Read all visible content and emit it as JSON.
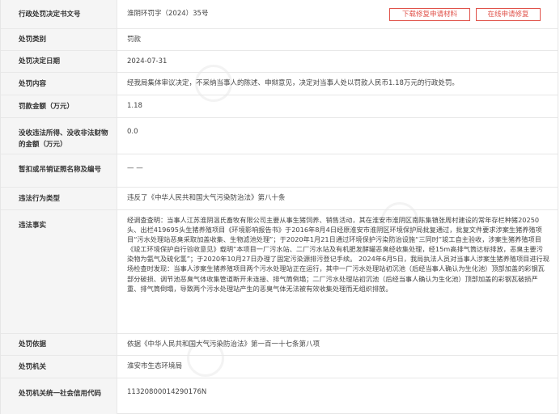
{
  "doc_number": {
    "label": "行政处罚决定书文号",
    "value": "淮阴环罚字（2024）35号"
  },
  "buttons": {
    "download": "下载修复申请材料",
    "online": "在线申请修复"
  },
  "category": {
    "label": "处罚类别",
    "value": "罚款"
  },
  "date": {
    "label": "处罚决定日期",
    "value": "2024-07-31"
  },
  "content": {
    "label": "处罚内容",
    "value": "经我局集体审议决定，不采纳当事人的陈述、申辩意见，决定对当事人处以罚款人民币1.18万元的行政处罚。"
  },
  "amount": {
    "label": "罚款金额（万元）",
    "value": "1.18"
  },
  "confiscation": {
    "label": "没收违法所得、没收非法财物的金额（万元）",
    "value": "0.0"
  },
  "license": {
    "label": "暂扣或吊销证照名称及编号",
    "value": "— —"
  },
  "violation_type": {
    "label": "违法行为类型",
    "value": "违反了《中华人民共和国大气污染防治法》第八十条"
  },
  "facts": {
    "label": "违法事实",
    "value": "经调查查明：当事人江苏淮阴温氏畜牧有限公司主要从事生猪饲养、销售活动，其在淮安市淮阴区南陈集镇张周村建设的常年存栏种猪20250头、出栏419695头生猪养殖项目《环境影响报告书》于2016年8月4日经原淮安市淮阴区环境保护局批复通过，批复文件要求涉案生猪养殖项目“污水处理站恶臭采取加盖收集、生物滤池处理”；于2020年1月21日通过环境保护污染防治设施“三同时”竣工自主验收，涉案生猪养殖项目《竣工环境保护自行验收意见》载明“本项目一厂污水站、二厂污水站及有机肥发酵罐恶臭经收集处理，经15m高排气筒达标排放，恶臭主要污染物为氨气及硫化氢”；于2020年10月27日办理了固定污染源排污登记手续。 2024年6月5日，我局执法人员对当事人涉案生猪养殖项目进行现场检查时发现：当事人涉案生猪养殖项目两个污水处理站正在运行，其中一厂污水处理站初沉池（后经当事人确认为生化池）顶部加盖的彩钢瓦部分破损、调节池恶臭气体收集管道断开未连接、排气筒倒塌；二厂污水处理站初沉池（后经当事人确认为生化池）顶部加盖的彩钢瓦破损严重、排气筒倒塌，导致两个污水处理站产生的恶臭气体无法被有效收集处理而无组织排放。"
  },
  "basis": {
    "label": "处罚依据",
    "value": "依据《中华人民共和国大气污染防治法》第一百一十七条第八项"
  },
  "authority": {
    "label": "处罚机关",
    "value": "淮安市生态环境局"
  },
  "credit_code": {
    "label": "处罚机关统一社会信用代码",
    "value": "11320800014290176N"
  },
  "colors": {
    "accent": "#e0524a",
    "label_bg": "#f5f5f5",
    "border": "#e8e8e8"
  }
}
